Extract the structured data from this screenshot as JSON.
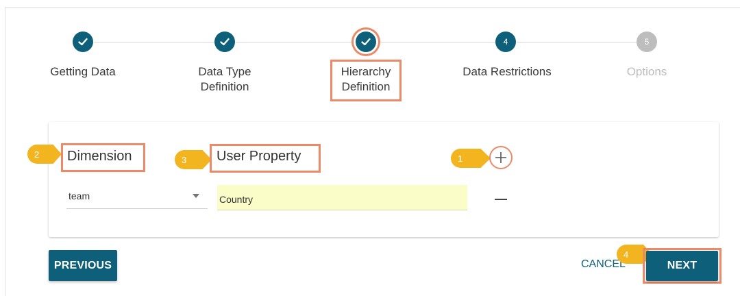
{
  "stepper": {
    "steps": [
      {
        "label": "Getting Data",
        "number": "1",
        "state": "done"
      },
      {
        "label": "Data Type\nDefinition",
        "number": "2",
        "state": "done"
      },
      {
        "label": "Hierarchy\nDefinition",
        "number": "3",
        "state": "current"
      },
      {
        "label": "Data Restrictions",
        "number": "4",
        "state": "active"
      },
      {
        "label": "Options",
        "number": "5",
        "state": "future"
      }
    ]
  },
  "hierarchy": {
    "dimension_header": "Dimension",
    "user_property_header": "User Property",
    "rows": [
      {
        "dimension": "team",
        "user_property": "Country"
      }
    ]
  },
  "callouts": {
    "plus": "1",
    "dimension": "2",
    "user_property": "3",
    "next": "4"
  },
  "actions": {
    "previous_label": "PREVIOUS",
    "cancel_label": "CANCEL",
    "next_label": "NEXT"
  },
  "colors": {
    "primary": "#0d5f7a",
    "highlight": "#ec8a67",
    "callout": "#f2b51f",
    "input_highlight": "#fbfdc8",
    "inactive": "#bdbdbd"
  },
  "icons": {
    "done": "check-icon",
    "add": "plus-icon",
    "remove": "minus-icon",
    "dropdown": "caret-down-icon"
  }
}
